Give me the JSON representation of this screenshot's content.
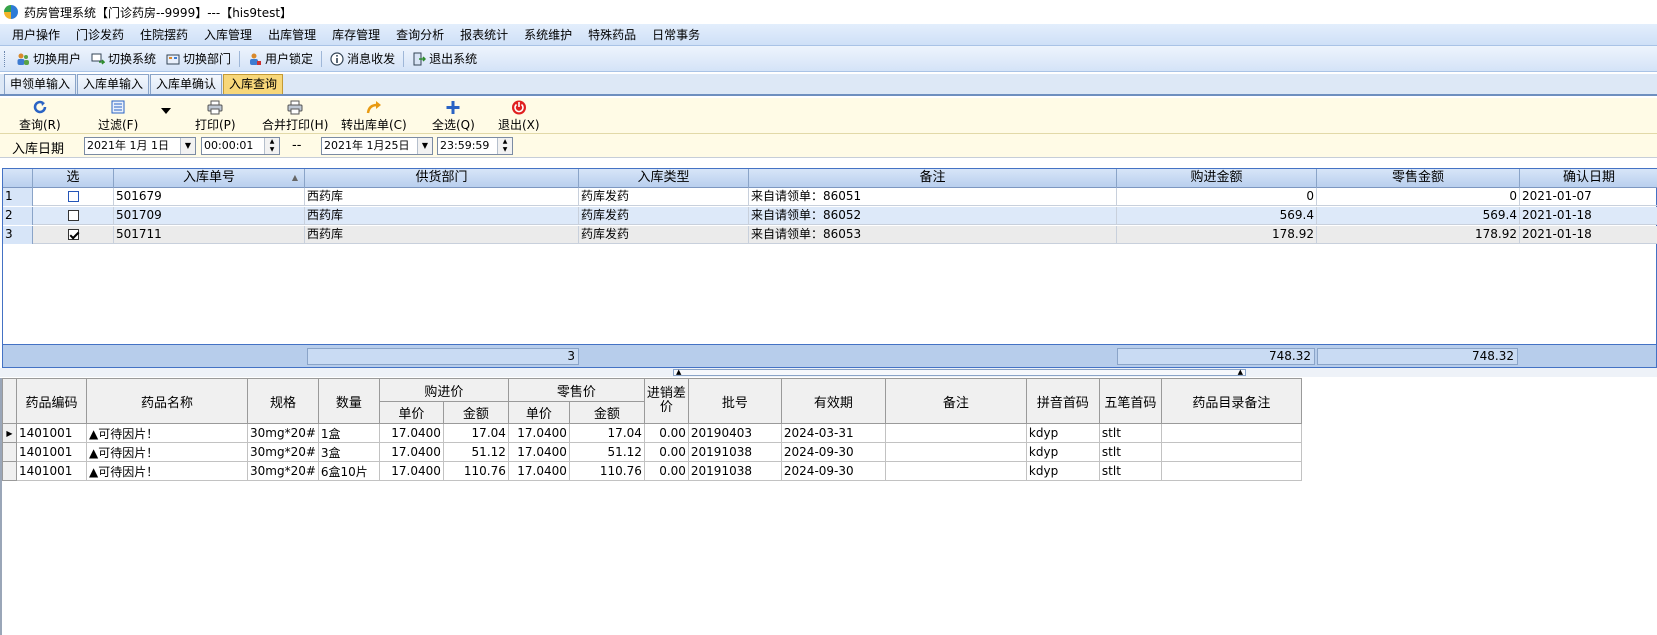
{
  "window": {
    "title": "药房管理系统【门诊药房--9999】---【his9test】"
  },
  "menu": [
    "用户操作",
    "门诊发药",
    "住院摆药",
    "入库管理",
    "出库管理",
    "库存管理",
    "查询分析",
    "报表统计",
    "系统维护",
    "特殊药品",
    "日常事务"
  ],
  "toolbar": {
    "switch_user": "切换用户",
    "switch_system": "切换系统",
    "switch_dept": "切换部门",
    "lock_user": "用户锁定",
    "messages": "消息收发",
    "exit_system": "退出系统"
  },
  "tabs": [
    "申领单输入",
    "入库单输入",
    "入库单确认",
    "入库查询"
  ],
  "active_tab": "入库查询",
  "actions": {
    "query": "查询(R)",
    "filter": "过滤(F)",
    "print": "打印(P)",
    "merge_print": "合并打印(H)",
    "export": "转出库单(C)",
    "select_all": "全选(Q)",
    "exit": "退出(X)"
  },
  "filter": {
    "label": "入库日期",
    "start_date": "2021年 1月 1日",
    "start_time": "00:00:01",
    "separator": "--",
    "end_date": "2021年 1月25日",
    "end_time": "23:59:59"
  },
  "receipts": {
    "columns": [
      "选",
      "入库单号",
      "供货部门",
      "入库类型",
      "备注",
      "购进金额",
      "零售金额",
      "确认日期"
    ],
    "rows": [
      {
        "idx": "1",
        "checked": false,
        "no": "501679",
        "dept": "西药库",
        "type": "药库发药",
        "note": "来自请领单：86051",
        "purchase": "0",
        "retail": "0",
        "date": "2021-01-07"
      },
      {
        "idx": "2",
        "checked": false,
        "no": "501709",
        "dept": "西药库",
        "type": "药库发药",
        "note": "来自请领单：86052",
        "purchase": "569.4",
        "retail": "569.4",
        "date": "2021-01-18"
      },
      {
        "idx": "3",
        "checked": true,
        "no": "501711",
        "dept": "西药库",
        "type": "药库发药",
        "note": "来自请领单：86053",
        "purchase": "178.92",
        "retail": "178.92",
        "date": "2021-01-18"
      }
    ],
    "totals": {
      "count": "3",
      "purchase": "748.32",
      "retail": "748.32"
    }
  },
  "details": {
    "headers": {
      "code": "药品编码",
      "name": "药品名称",
      "spec": "规格",
      "qty": "数量",
      "purchase_group": "购进价",
      "retail_group": "零售价",
      "unit_price": "单价",
      "amount": "金额",
      "diff": "进销差价",
      "batch": "批号",
      "expiry": "有效期",
      "note": "备注",
      "pinyin": "拼音首码",
      "wubi": "五笔首码",
      "catalog_note": "药品目录备注"
    },
    "rows": [
      {
        "code": "1401001",
        "name": "▲可待因片！",
        "spec": "30mg*20#",
        "qty": "1盒",
        "p_price": "17.0400",
        "p_amount": "17.04",
        "r_price": "17.0400",
        "r_amount": "17.04",
        "diff": "0.00",
        "batch": "20190403",
        "expiry": "2024-03-31",
        "note": "",
        "pinyin": "kdyp",
        "wubi": "stlt",
        "catalog_note": ""
      },
      {
        "code": "1401001",
        "name": "▲可待因片！",
        "spec": "30mg*20#",
        "qty": "3盒",
        "p_price": "17.0400",
        "p_amount": "51.12",
        "r_price": "17.0400",
        "r_amount": "51.12",
        "diff": "0.00",
        "batch": "20191038",
        "expiry": "2024-09-30",
        "note": "",
        "pinyin": "kdyp",
        "wubi": "stlt",
        "catalog_note": ""
      },
      {
        "code": "1401001",
        "name": "▲可待因片！",
        "spec": "30mg*20#",
        "qty": "6盒10片",
        "p_price": "17.0400",
        "p_amount": "110.76",
        "r_price": "17.0400",
        "r_amount": "110.76",
        "diff": "0.00",
        "batch": "20191038",
        "expiry": "2024-09-30",
        "note": "",
        "pinyin": "kdyp",
        "wubi": "stlt",
        "catalog_note": ""
      }
    ]
  },
  "colors": {
    "accent": "#4472c4",
    "active_tab": "#f7d77a",
    "toolbar_bg": "#fffbe6",
    "row_alt": "#dde9f9"
  }
}
